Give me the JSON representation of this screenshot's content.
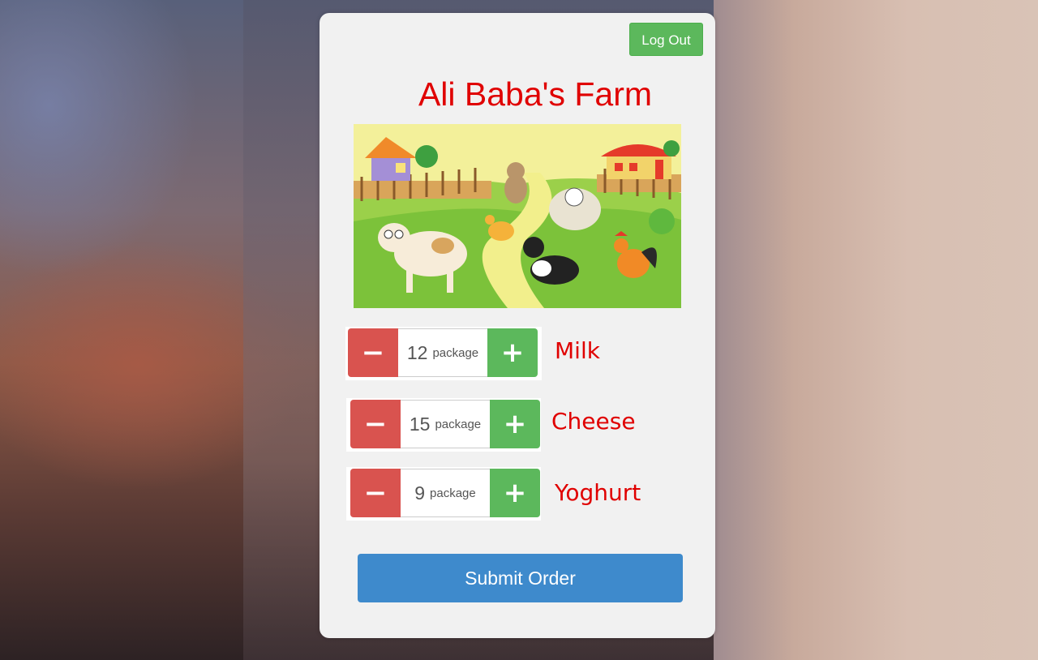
{
  "header": {
    "logout_label": "Log Out",
    "title": "Ali Baba's Farm"
  },
  "products": [
    {
      "name": "Milk",
      "quantity": "12",
      "unit": "package"
    },
    {
      "name": "Cheese",
      "quantity": "15",
      "unit": "package"
    },
    {
      "name": "Yoghurt",
      "quantity": "9",
      "unit": "package"
    }
  ],
  "controls": {
    "minus_symbol": "−",
    "plus_symbol": "+",
    "minus_icon": "minus-icon",
    "plus_icon": "plus-icon"
  },
  "submit_label": "Submit Order",
  "colors": {
    "title": "#e00000",
    "minus": "#d9534f",
    "plus": "#5cb85c",
    "submit": "#3e8acc",
    "logout": "#5cb85c"
  }
}
